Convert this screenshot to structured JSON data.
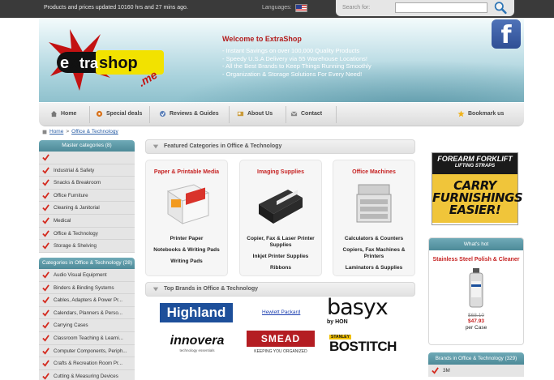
{
  "topbar": {
    "updated": "Products and prices updated 10160 hrs and 27 mins ago.",
    "languages_label": "Languages:",
    "search_label": "Search for:",
    "search_value": ""
  },
  "banner": {
    "logo_text_e": "e",
    "logo_text_x": "x",
    "logo_text_tra": "tra",
    "logo_text_shop": "shop",
    "logo_text_me": ".me",
    "welcome": "Welcome to ExtraShop",
    "bullets": [
      "- Instant Savings on over 100,000 Quality Products",
      "- Speedy U.S.A Delivery via 55 Warehouse Locations!",
      "- All the Best Brands to Keep Things Running Smoothly",
      "- Organization & Storage Solutions For Every Need!"
    ],
    "facebook_letter": "f"
  },
  "nav": {
    "home": "Home",
    "special": "Special deals",
    "reviews": "Reviews & Guides",
    "about": "About Us",
    "contact": "Contact",
    "bookmark": "Bookmark us"
  },
  "breadcrumb": {
    "home": "Home",
    "sep": ">",
    "current": "Office & Technology"
  },
  "sidebar": {
    "master_title": "Master categories (8)",
    "master_items": [
      "",
      "Industrial & Safety",
      "Snacks & Breakroom",
      "Office Furniture",
      "Cleaning & Janitorial",
      "Medical",
      "Office & Technology",
      "Storage & Shelving"
    ],
    "cat_title": "Categories in Office & Technology (28)",
    "cat_items": [
      "Audio Visual Equipment",
      "Binders & Binding Systems",
      "Cables, Adapters & Power Pr...",
      "Calendars, Planners & Perso...",
      "Carrying Cases",
      "Classroom Teaching & Learni...",
      "Computer Components, Periph...",
      "Crafts & Recreation Room Pr...",
      "Cutting & Measuring Devices"
    ]
  },
  "featured": {
    "title": "Featured Categories in Office & Technology",
    "cards": [
      {
        "title": "Paper & Printable Media",
        "links": [
          "Printer Paper",
          "Notebooks & Writing Pads",
          "Writing Pads"
        ]
      },
      {
        "title": "Imaging Supplies",
        "links": [
          "Copier, Fax & Laser Printer Supplies",
          "Inkjet Printer Supplies",
          "Ribbons"
        ]
      },
      {
        "title": "Office Machines",
        "links": [
          "Calculators & Counters",
          "Copiers, Fax Machines & Printers",
          "Laminators & Supplies"
        ]
      }
    ]
  },
  "brands": {
    "title": "Top Brands in Office & Technology",
    "highland": "Highland",
    "hp": "Hewlett Packard",
    "basyx": "basyx",
    "basyx_sub": "by HON",
    "innovera": "innovera",
    "innovera_sub": "technology essentials",
    "smead": "SMEAD",
    "smead_sub": "KEEPING YOU ORGANIZED",
    "stanley": "STANLEY",
    "bostitch": "BOSTITCH"
  },
  "ad": {
    "line1": "FOREARM FORKLIFT",
    "line2": "LIFTING STRAPS",
    "big1": "CARRY",
    "big2": "FURNISHINGS",
    "big3": "EASIER!"
  },
  "hot": {
    "title": "What's hot",
    "product": "Stainless Steel Polish & Cleaner",
    "old_price": "$68.10",
    "new_price": "$47.93",
    "unit": "per Case"
  },
  "brand_side": {
    "title": "Brands in Office & Technology (329)",
    "items": [
      "3M"
    ]
  },
  "colors": {
    "accent_red": "#c62222",
    "teal_head": "#5a97a5",
    "link_blue": "#2b5fa6"
  }
}
